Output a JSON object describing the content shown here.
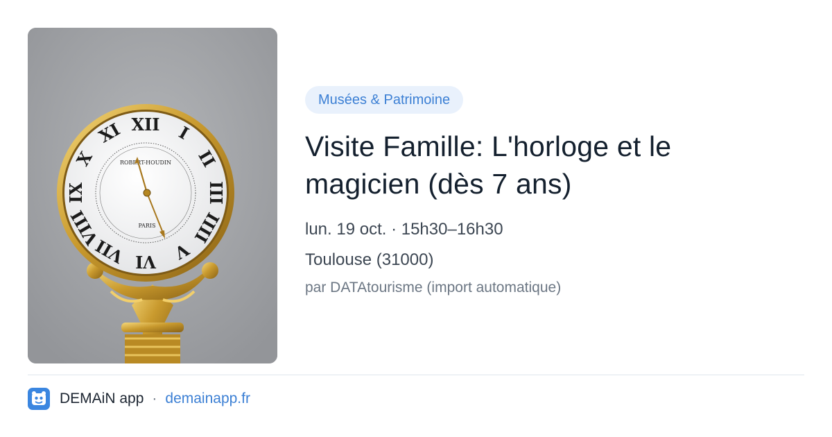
{
  "event": {
    "category": "Musées & Patrimoine",
    "title": "Visite Famille: L'horloge et le magicien (dès 7 ans)",
    "datetime": "lun. 19 oct. · 15h30–16h30",
    "location": "Toulouse (31000)",
    "source": "par DATAtourisme (import automatique)"
  },
  "image": {
    "dial_top_text": "ROBERT-HOUDIN",
    "dial_bottom_text": "PARIS"
  },
  "footer": {
    "app_name": "DEMAiN app",
    "separator": "·",
    "link": "demainapp.fr"
  },
  "colors": {
    "accent": "#3b7fd4",
    "badge_bg": "#e9f1fc",
    "logo_bg": "#3a86e0",
    "title": "#14202e",
    "muted": "#6b7683"
  },
  "icons": {
    "app_logo": "demain-app-logo-icon"
  }
}
